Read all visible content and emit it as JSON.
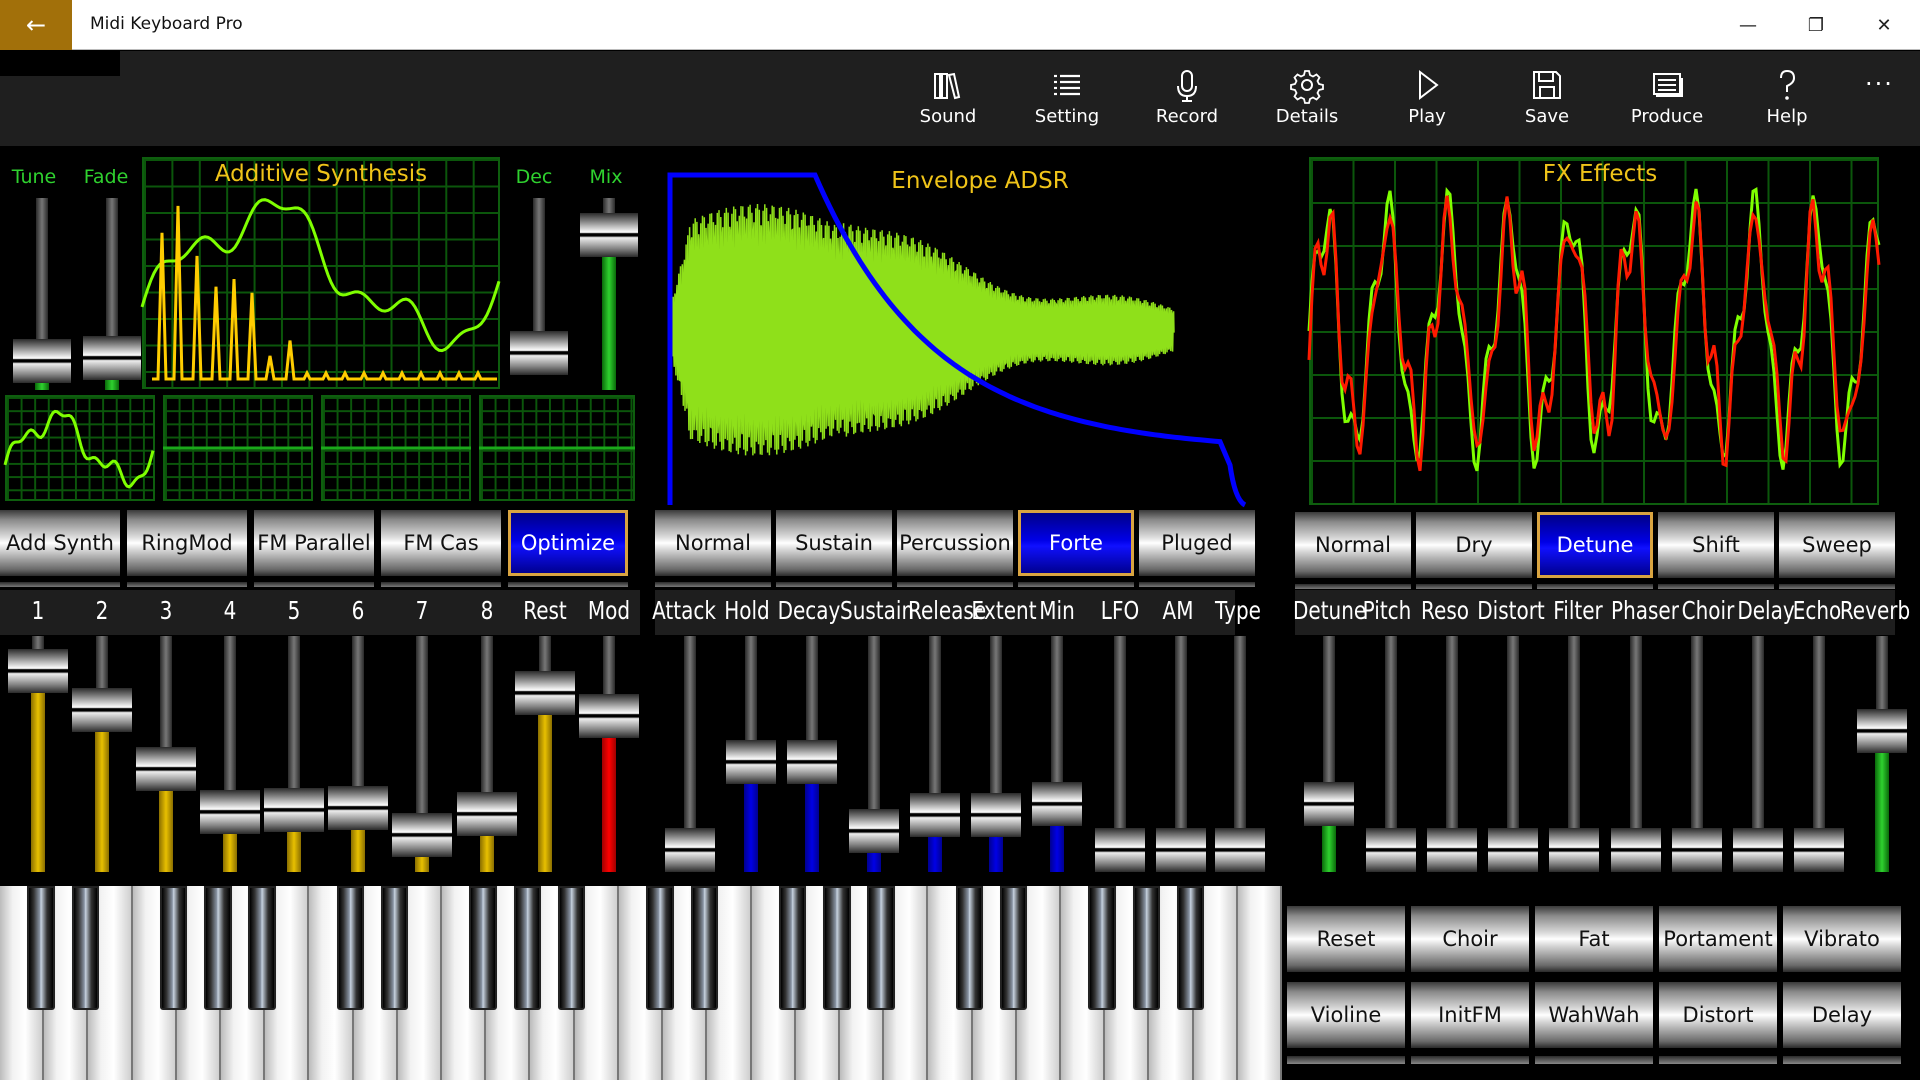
{
  "window": {
    "title": "Midi Keyboard Pro",
    "back": "←",
    "minimize": "—",
    "restore": "❐",
    "close": "✕"
  },
  "commands": [
    {
      "label": "Sound",
      "icon": "library-icon"
    },
    {
      "label": "Setting",
      "icon": "list-icon"
    },
    {
      "label": "Record",
      "icon": "microphone-icon"
    },
    {
      "label": "Details",
      "icon": "gear-icon"
    },
    {
      "label": "Play",
      "icon": "play-icon"
    },
    {
      "label": "Save",
      "icon": "save-icon"
    },
    {
      "label": "Produce",
      "icon": "document-icon"
    },
    {
      "label": "Help",
      "icon": "help-icon"
    }
  ],
  "more": "···",
  "synth": {
    "title": "Additive Synthesis",
    "labels": {
      "tune": "Tune",
      "fade": "Fade",
      "dec": "Dec",
      "mix": "Mix"
    },
    "sliders": {
      "tune": 0.05,
      "fade": 0.07,
      "dec": 0.1,
      "mix": 0.9
    },
    "modes": [
      {
        "label": "Add Synth",
        "selected": false
      },
      {
        "label": "RingMod",
        "selected": false
      },
      {
        "label": "FM Parallel",
        "selected": false
      },
      {
        "label": "FM Cas",
        "selected": false
      },
      {
        "label": "Optimize",
        "selected": true
      }
    ],
    "harmonics": [
      {
        "label": "1",
        "value": 0.93,
        "color": "#e8c000"
      },
      {
        "label": "2",
        "value": 0.73,
        "color": "#e8c000"
      },
      {
        "label": "3",
        "value": 0.42,
        "color": "#e8c000"
      },
      {
        "label": "4",
        "value": 0.2,
        "color": "#e8c000"
      },
      {
        "label": "5",
        "value": 0.21,
        "color": "#e8c000"
      },
      {
        "label": "6",
        "value": 0.22,
        "color": "#e8c000"
      },
      {
        "label": "7",
        "value": 0.08,
        "color": "#e8c000"
      },
      {
        "label": "8",
        "value": 0.19,
        "color": "#e8c000"
      },
      {
        "label": "Rest",
        "value": 0.82,
        "color": "#e8c000"
      },
      {
        "label": "Mod",
        "value": 0.7,
        "color": "#ff0000"
      }
    ]
  },
  "envelope": {
    "title": "Envelope ADSR",
    "modes": [
      {
        "label": "Normal",
        "selected": false
      },
      {
        "label": "Sustain",
        "selected": false
      },
      {
        "label": "Percussion",
        "selected": false
      },
      {
        "label": "Forte",
        "selected": true
      },
      {
        "label": "Pluged",
        "selected": false
      }
    ],
    "params": [
      {
        "label": "Attack",
        "value": 0.0
      },
      {
        "label": "Hold",
        "value": 0.46
      },
      {
        "label": "Decay",
        "value": 0.46
      },
      {
        "label": "Sustain",
        "value": 0.1
      },
      {
        "label": "Release",
        "value": 0.18
      },
      {
        "label": "Extent",
        "value": 0.18
      },
      {
        "label": "Min",
        "value": 0.24
      },
      {
        "label": "LFO",
        "value": 0.0
      },
      {
        "label": "AM",
        "value": 0.0
      },
      {
        "label": "Type",
        "value": 0.0
      }
    ]
  },
  "fx": {
    "title": "FX Effects",
    "modes": [
      {
        "label": "Normal",
        "selected": false
      },
      {
        "label": "Dry",
        "selected": false
      },
      {
        "label": "Detune",
        "selected": true
      },
      {
        "label": "Shift",
        "selected": false
      },
      {
        "label": "Sweep",
        "selected": false
      }
    ],
    "params": [
      {
        "label": "Detune",
        "value": 0.24
      },
      {
        "label": "Pitch",
        "value": 0.0
      },
      {
        "label": "Reso",
        "value": 0.0
      },
      {
        "label": "Distort",
        "value": 0.0
      },
      {
        "label": "Filter",
        "value": 0.0
      },
      {
        "label": "Phaser",
        "value": 0.0
      },
      {
        "label": "Choir",
        "value": 0.0
      },
      {
        "label": "Delay",
        "value": 0.0
      },
      {
        "label": "Echo",
        "value": 0.0
      },
      {
        "label": "Reverb",
        "value": 0.62
      }
    ],
    "presets": [
      "Reset",
      "Choir",
      "Fat",
      "Portament",
      "Vibrato",
      "Violine",
      "InitFM",
      "WahWah",
      "Distort",
      "Delay"
    ]
  },
  "colors": {
    "accent": "#a2700a",
    "selected": "#0000e6",
    "selected_border": "#d9a441",
    "scope_green": "#7fff00",
    "scope_yellow": "#f0c419",
    "envelope_blue": "#0000ff",
    "fx_red": "#ff1a00"
  }
}
